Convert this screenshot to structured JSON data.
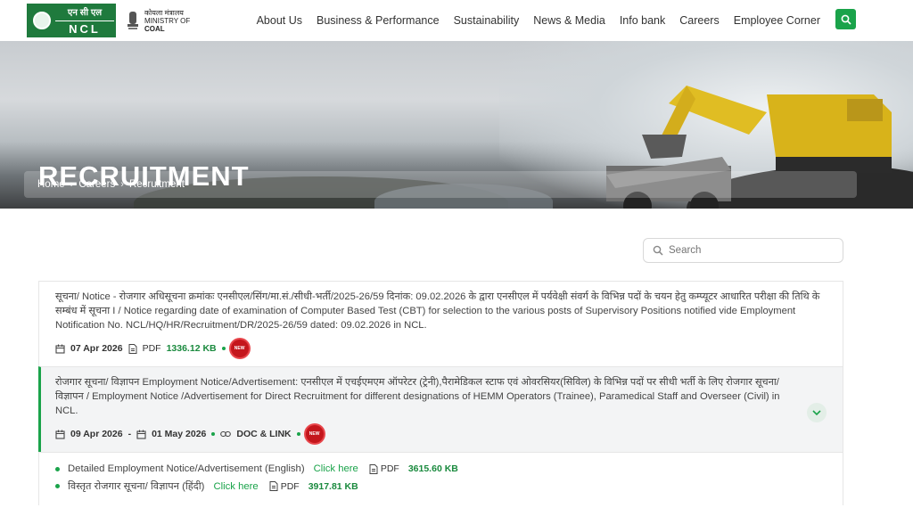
{
  "header": {
    "logo": {
      "hindi": "एन सी एल",
      "english": "NCL"
    },
    "ministry": {
      "hindi": "कोयला मंत्रालय",
      "line1": "MINISTRY OF",
      "line2": "COAL"
    },
    "nav": [
      "About Us",
      "Business & Performance",
      "Sustainability",
      "News & Media",
      "Info bank",
      "Careers",
      "Employee Corner"
    ]
  },
  "hero": {
    "title": "RECRUITMENT",
    "breadcrumb": [
      "Home",
      "Careers",
      "Recruitment"
    ]
  },
  "search": {
    "placeholder": "Search"
  },
  "items": [
    {
      "title": "सूचना/ Notice - रोजगार अधिसूचना क्रमांकः एनसीएल/सिंग/मा.सं./सीधी-भर्ती/2025-26/59 दिनांक: 09.02.2026 के द्वारा एनसीएल में पर्यवेक्षी संवर्ग के विभिन्न पदों के चयन हेतु कम्प्यूटर आधारित परीक्षा की तिथि के सम्बंध में सूचना I / Notice regarding date of examination of Computer Based Test (CBT) for selection to the various posts of Supervisory Positions notified vide Employment Notification No. NCL/HQ/HR/Recruitment/DR/2025-26/59 dated: 09.02.2026 in NCL.",
      "date": "07 Apr 2026",
      "type": "PDF",
      "size": "1336.12 KB",
      "badge": "NEW"
    },
    {
      "title": "रोजगार सूचना/ विज्ञापन Employment Notice/Advertisement: एनसीएल में एचईएमएम ऑपरेटर (ट्रेनी),पैरामेडिकल स्टाफ एवं ओवरसियर(सिविल) के विभिन्न पदों पर सीधी भर्ती के लिए रोजगार सूचना/ विज्ञापन / Employment Notice /Advertisement for Direct Recruitment for different designations of HEMM Operators (Trainee), Paramedical Staff and Overseer (Civil) in NCL.",
      "date_from": "09 Apr 2026",
      "date_sep": "-",
      "date_to": "01 May 2026",
      "type": "DOC & LINK",
      "badge": "NEW",
      "subitems": [
        {
          "label": "Detailed Employment Notice/Advertisement (English)",
          "link": "Click here",
          "type": "PDF",
          "size": "3615.60 KB"
        },
        {
          "label": "विस्तृत रोजगार सूचना/ विज्ञापन (हिंदी)",
          "link": "Click here",
          "type": "PDF",
          "size": "3917.81 KB"
        }
      ]
    }
  ],
  "colors": {
    "brand_green": "#1f7a3d",
    "accent_green": "#1aa34a",
    "new_badge": "#c4161c"
  }
}
